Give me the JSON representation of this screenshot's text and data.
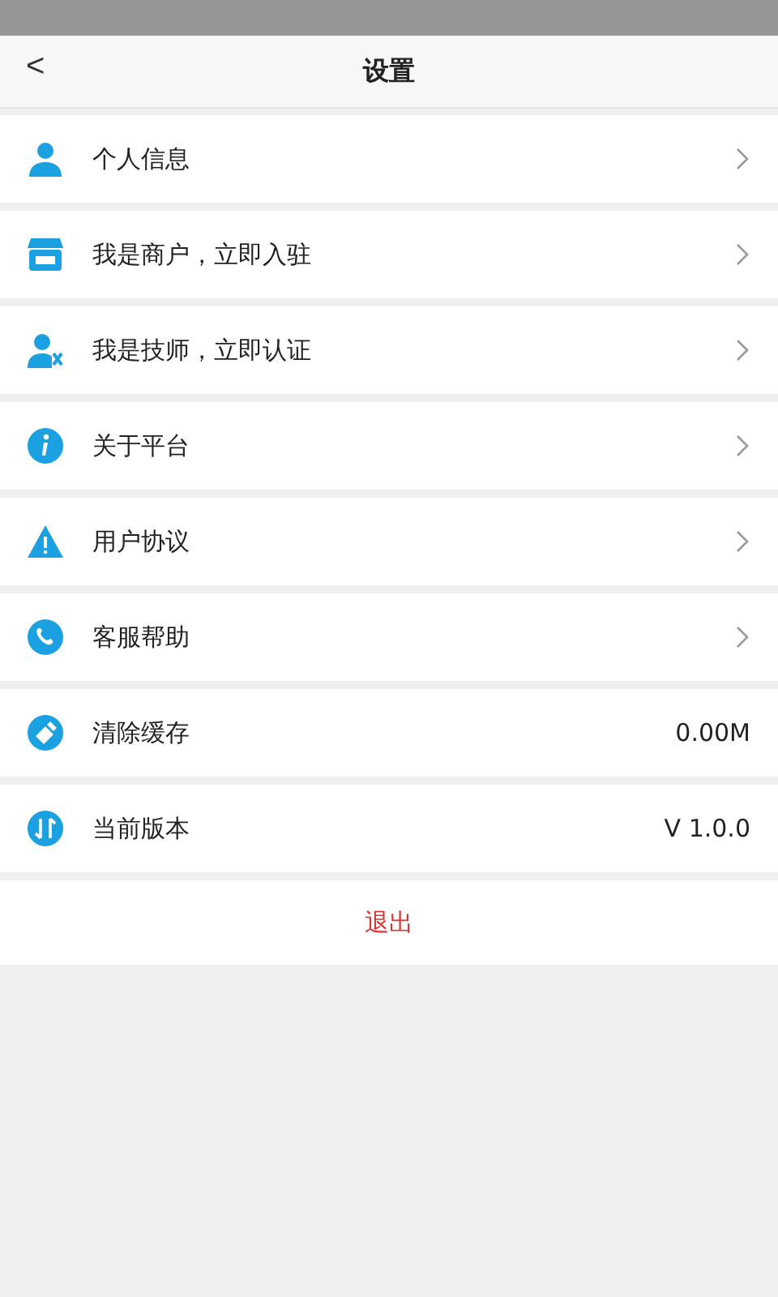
{
  "header": {
    "back": "<",
    "title": "设置"
  },
  "items": [
    {
      "label": "个人信息",
      "kind": "link"
    },
    {
      "label": "我是商户，立即入驻",
      "kind": "link"
    },
    {
      "label": "我是技师，立即认证",
      "kind": "link"
    },
    {
      "label": "关于平台",
      "kind": "link"
    },
    {
      "label": "用户协议",
      "kind": "link"
    },
    {
      "label": "客服帮助",
      "kind": "link"
    },
    {
      "label": "清除缓存",
      "kind": "value",
      "value": "0.00M"
    },
    {
      "label": "当前版本",
      "kind": "value",
      "value": "V 1.0.0"
    }
  ],
  "logout": "退出"
}
